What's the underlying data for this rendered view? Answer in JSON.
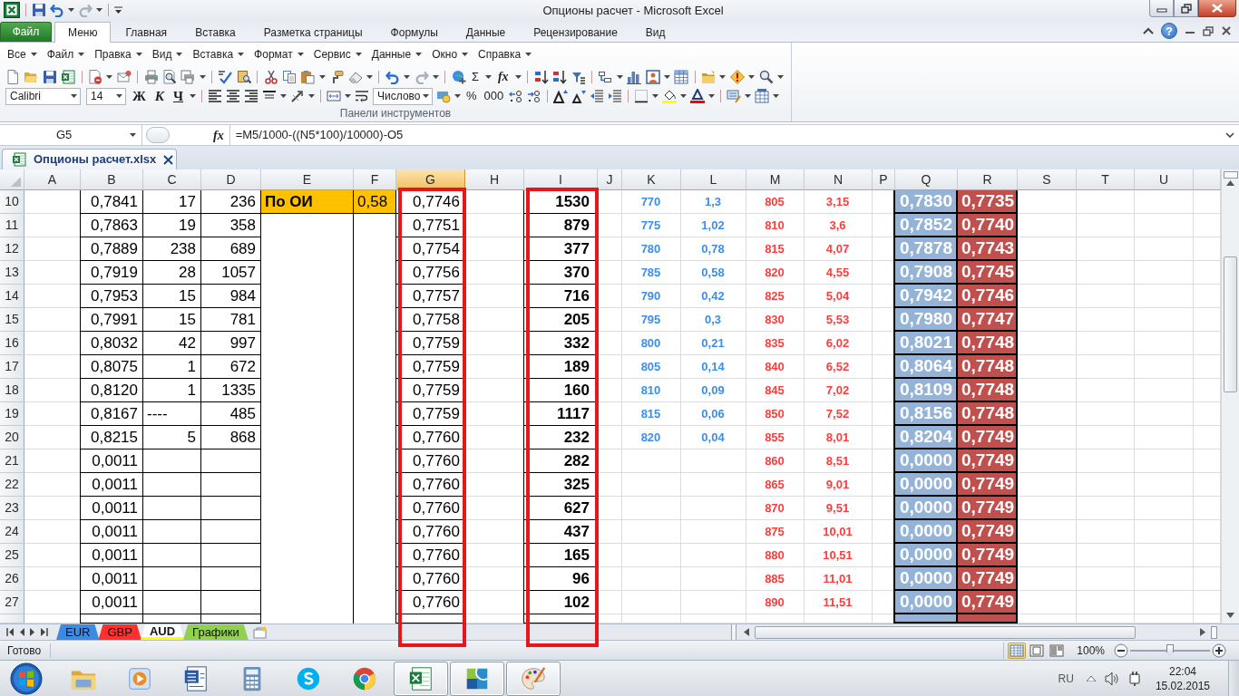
{
  "window": {
    "title": "Опционы расчет - Microsoft Excel"
  },
  "ribbon": {
    "tabs": [
      {
        "label": "Файл",
        "kind": "file",
        "selected": false
      },
      {
        "label": "Меню",
        "kind": "tab",
        "selected": true
      },
      {
        "label": "Главная",
        "kind": "tab",
        "selected": false
      },
      {
        "label": "Вставка",
        "kind": "tab",
        "selected": false
      },
      {
        "label": "Разметка страницы",
        "kind": "tab",
        "selected": false
      },
      {
        "label": "Формулы",
        "kind": "tab",
        "selected": false
      },
      {
        "label": "Данные",
        "kind": "tab",
        "selected": false
      },
      {
        "label": "Рецензирование",
        "kind": "tab",
        "selected": false
      },
      {
        "label": "Вид",
        "kind": "tab",
        "selected": false
      }
    ],
    "help_button": "?",
    "menu_bar": [
      "Все",
      "Файл",
      "Правка",
      "Вид",
      "Вставка",
      "Формат",
      "Сервис",
      "Данные",
      "Окно",
      "Справка"
    ],
    "toolbar": {
      "sum": "Σ",
      "function": "fx",
      "font": "Calibri",
      "font_size": "14",
      "bold": "Ж",
      "italic": "К",
      "underline": "Ч",
      "number_format": "Числово",
      "percent": "%",
      "thousands": "000"
    },
    "group_label": "Панели инструментов"
  },
  "formula_bar": {
    "name_box": "G5",
    "function_button": "fx",
    "formula": "=M5/1000-((N5*100)/10000)-O5"
  },
  "workbook_tab": {
    "label": "Опционы расчет.xlsx"
  },
  "columns": [
    {
      "label": "A",
      "kind": "blank",
      "selected": false,
      "highlighted": false
    },
    {
      "label": "B",
      "kind": "boxed",
      "selected": false,
      "highlighted": false
    },
    {
      "label": "C",
      "kind": "boxed",
      "selected": false,
      "highlighted": false
    },
    {
      "label": "D",
      "kind": "boxed",
      "selected": false,
      "highlighted": false
    },
    {
      "label": "E",
      "kind": "open",
      "selected": false,
      "highlighted": false
    },
    {
      "label": "F",
      "kind": "open",
      "selected": false,
      "highlighted": false
    },
    {
      "label": "G",
      "kind": "boxed",
      "selected": true,
      "highlighted": true
    },
    {
      "label": "H",
      "kind": "blank",
      "selected": false,
      "highlighted": false
    },
    {
      "label": "I",
      "kind": "strong",
      "selected": false,
      "highlighted": true
    },
    {
      "label": "J",
      "kind": "blank",
      "selected": false,
      "highlighted": false
    },
    {
      "label": "K",
      "kind": "colored",
      "color": "#3c8ee8",
      "selected": false,
      "highlighted": false
    },
    {
      "label": "L",
      "kind": "colored",
      "color": "#3c8ee8",
      "selected": false,
      "highlighted": false
    },
    {
      "label": "M",
      "kind": "colored",
      "color": "#ff3b3b",
      "selected": false,
      "highlighted": false
    },
    {
      "label": "N",
      "kind": "colored",
      "color": "#ff3b3b",
      "selected": false,
      "highlighted": false
    },
    {
      "label": "P",
      "kind": "blank",
      "selected": false,
      "highlighted": false
    },
    {
      "label": "Q",
      "kind": "filled",
      "color": "#95b3d7",
      "selected": false,
      "highlighted": false
    },
    {
      "label": "R",
      "kind": "filled",
      "color": "#c0504d",
      "selected": false,
      "highlighted": false
    },
    {
      "label": "S",
      "kind": "blank",
      "selected": false,
      "highlighted": false
    },
    {
      "label": "T",
      "kind": "blank",
      "selected": false,
      "highlighted": false
    },
    {
      "label": "U",
      "kind": "blank",
      "selected": false,
      "highlighted": false
    }
  ],
  "rows": [
    {
      "header": "10",
      "cells": [
        null,
        "0,7841",
        "17",
        "236",
        {
          "text": "По ОИ",
          "kind": "text",
          "color": "#ffc000",
          "bold": true
        },
        {
          "text": "0,58",
          "kind": "text",
          "color": "#ffc000"
        },
        "0,7746",
        null,
        "1530",
        null,
        "770",
        "1,3",
        "805",
        "3,15",
        null,
        "0,7830",
        "0,7735"
      ]
    },
    {
      "header": "11",
      "cells": [
        null,
        "0,7863",
        "19",
        "358",
        null,
        null,
        "0,7751",
        null,
        "879",
        null,
        "775",
        "1,02",
        "810",
        "3,6",
        null,
        "0,7852",
        "0,7740"
      ]
    },
    {
      "header": "12",
      "cells": [
        null,
        "0,7889",
        "238",
        "689",
        null,
        null,
        "0,7754",
        null,
        "377",
        null,
        "780",
        "0,78",
        "815",
        "4,07",
        null,
        "0,7878",
        "0,7743"
      ]
    },
    {
      "header": "13",
      "cells": [
        null,
        "0,7919",
        "28",
        "1057",
        null,
        null,
        "0,7756",
        null,
        "370",
        null,
        "785",
        "0,58",
        "820",
        "4,55",
        null,
        "0,7908",
        "0,7745"
      ]
    },
    {
      "header": "14",
      "cells": [
        null,
        "0,7953",
        "15",
        "984",
        null,
        null,
        "0,7757",
        null,
        "716",
        null,
        "790",
        "0,42",
        "825",
        "5,04",
        null,
        "0,7942",
        "0,7746"
      ]
    },
    {
      "header": "15",
      "cells": [
        null,
        "0,7991",
        "15",
        "781",
        null,
        null,
        "0,7758",
        null,
        "205",
        null,
        "795",
        "0,3",
        "830",
        "5,53",
        null,
        "0,7980",
        "0,7747"
      ]
    },
    {
      "header": "16",
      "cells": [
        null,
        "0,8032",
        "42",
        "997",
        null,
        null,
        "0,7759",
        null,
        "332",
        null,
        "800",
        "0,21",
        "835",
        "6,02",
        null,
        "0,8021",
        "0,7748"
      ]
    },
    {
      "header": "17",
      "cells": [
        null,
        "0,8075",
        "1",
        "672",
        null,
        null,
        "0,7759",
        null,
        "189",
        null,
        "805",
        "0,14",
        "840",
        "6,52",
        null,
        "0,8064",
        "0,7748"
      ]
    },
    {
      "header": "18",
      "cells": [
        null,
        "0,8120",
        "1",
        "1335",
        null,
        null,
        "0,7759",
        null,
        "160",
        null,
        "810",
        "0,09",
        "845",
        "7,02",
        null,
        "0,8109",
        "0,7748"
      ]
    },
    {
      "header": "19",
      "cells": [
        null,
        "0,8167",
        {
          "text": "----",
          "kind": "text"
        },
        "485",
        null,
        null,
        "0,7759",
        null,
        "1117",
        null,
        "815",
        "0,06",
        "850",
        "7,52",
        null,
        "0,8156",
        "0,7748"
      ]
    },
    {
      "header": "20",
      "cells": [
        null,
        "0,8215",
        "5",
        "868",
        null,
        null,
        "0,7760",
        null,
        "232",
        null,
        "820",
        "0,04",
        "855",
        "8,01",
        null,
        "0,8204",
        "0,7749"
      ]
    },
    {
      "header": "21",
      "cells": [
        null,
        "0,0011",
        null,
        null,
        null,
        null,
        "0,7760",
        null,
        "282",
        null,
        null,
        null,
        "860",
        "8,51",
        null,
        "0,0000",
        "0,7749"
      ]
    },
    {
      "header": "22",
      "cells": [
        null,
        "0,0011",
        null,
        null,
        null,
        null,
        "0,7760",
        null,
        "325",
        null,
        null,
        null,
        "865",
        "9,01",
        null,
        "0,0000",
        "0,7749"
      ]
    },
    {
      "header": "23",
      "cells": [
        null,
        "0,0011",
        null,
        null,
        null,
        null,
        "0,7760",
        null,
        "627",
        null,
        null,
        null,
        "870",
        "9,51",
        null,
        "0,0000",
        "0,7749"
      ]
    },
    {
      "header": "24",
      "cells": [
        null,
        "0,0011",
        null,
        null,
        null,
        null,
        "0,7760",
        null,
        "437",
        null,
        null,
        null,
        "875",
        "10,01",
        null,
        "0,0000",
        "0,7749"
      ]
    },
    {
      "header": "25",
      "cells": [
        null,
        "0,0011",
        null,
        null,
        null,
        null,
        "0,7760",
        null,
        "165",
        null,
        null,
        null,
        "880",
        "10,51",
        null,
        "0,0000",
        "0,7749"
      ]
    },
    {
      "header": "26",
      "cells": [
        null,
        "0,0011",
        null,
        null,
        null,
        null,
        "0,7760",
        null,
        "96",
        null,
        null,
        null,
        "885",
        "11,01",
        null,
        "0,0000",
        "0,7749"
      ]
    },
    {
      "header": "27",
      "cells": [
        null,
        "0,0011",
        null,
        null,
        null,
        null,
        "0,7760",
        null,
        "102",
        null,
        null,
        null,
        "890",
        "11,51",
        null,
        "0,0000",
        "0,7749"
      ]
    }
  ],
  "sheet_tabs": [
    {
      "label": "EUR",
      "color": "#3d8be0",
      "selected": false
    },
    {
      "label": "GBP",
      "color": "#ff3030",
      "selected": false
    },
    {
      "label": "AUD",
      "color": "#ffff00",
      "selected": true
    },
    {
      "label": "Графики",
      "color": "#92d050",
      "selected": false
    }
  ],
  "status_bar": {
    "text": "Готово",
    "views": [
      {
        "kind": "normal",
        "selected": true
      },
      {
        "kind": "layout",
        "selected": false
      },
      {
        "kind": "pagebreak",
        "selected": false
      }
    ],
    "zoom": {
      "reading": "100%",
      "level": 0.5
    }
  },
  "taskbar": {
    "items": [
      {
        "kind": "folder",
        "running": false
      },
      {
        "kind": "player",
        "running": false
      },
      {
        "kind": "document",
        "running": false
      },
      {
        "kind": "calculator",
        "running": false
      },
      {
        "kind": "chat",
        "running": false
      },
      {
        "kind": "browser",
        "running": false
      },
      {
        "kind": "spreadsheet",
        "running": true
      },
      {
        "kind": "map",
        "running": true
      },
      {
        "kind": "palette",
        "running": true
      }
    ],
    "language": "RU",
    "time": "22:04",
    "date": "15.02.2015"
  }
}
